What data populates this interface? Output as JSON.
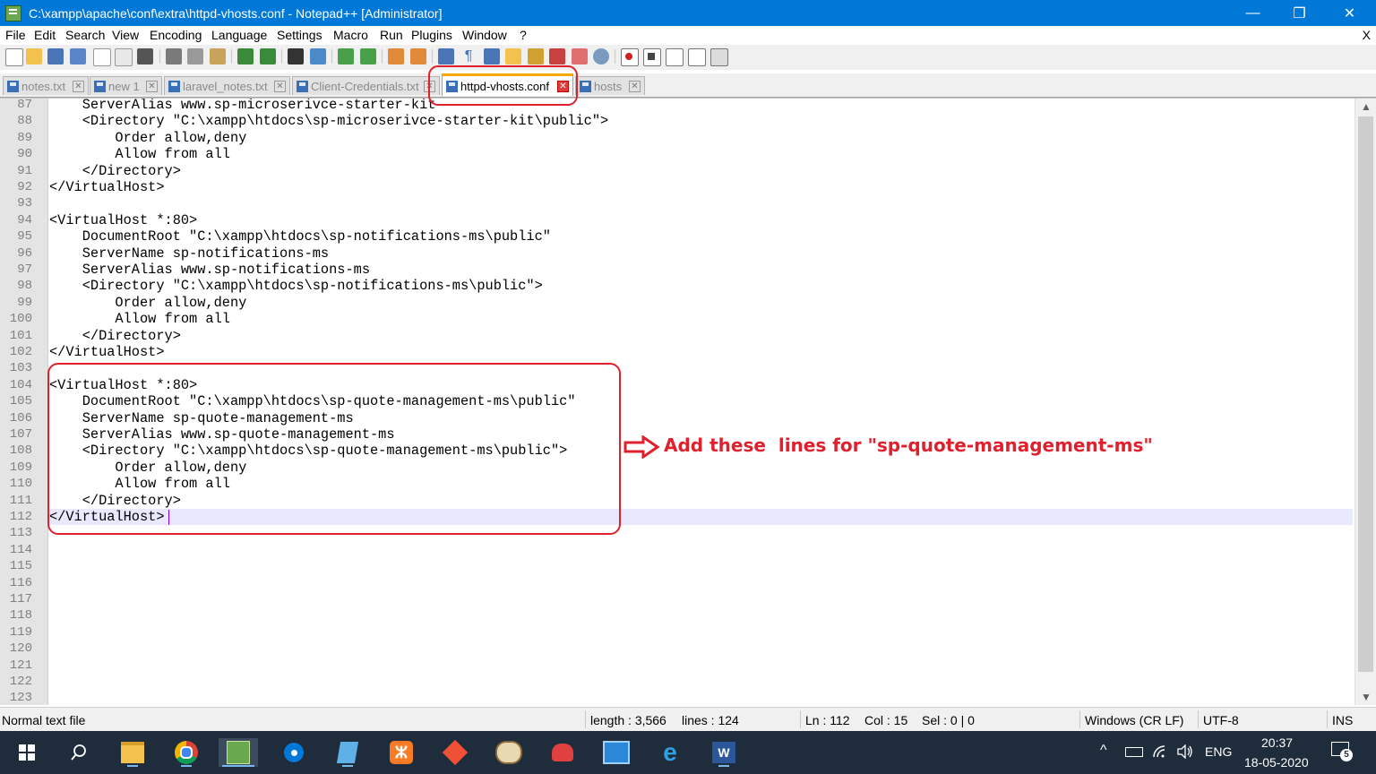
{
  "window": {
    "title": "C:\\xampp\\apache\\conf\\extra\\httpd-vhosts.conf - Notepad++ [Administrator]",
    "minimize_glyph": "—",
    "maximize_glyph": "❐",
    "close_glyph": "✕"
  },
  "menu": {
    "items": [
      "File",
      "Edit",
      "Search",
      "View",
      "Encoding",
      "Language",
      "Settings",
      "Macro",
      "Run",
      "Plugins",
      "Window",
      "?"
    ],
    "close_label": "X"
  },
  "tabs": [
    {
      "label": "notes.txt",
      "active": false
    },
    {
      "label": "new 1",
      "active": false
    },
    {
      "label": "laravel_notes.txt",
      "active": false
    },
    {
      "label": "Client-Credentials.txt",
      "active": false
    },
    {
      "label": "httpd-vhosts.conf",
      "active": true
    },
    {
      "label": "hosts",
      "active": false
    }
  ],
  "editor": {
    "first_line_number": 87,
    "current_line": 112,
    "lines": [
      "    ServerAlias www.sp-microserivce-starter-kit",
      "    <Directory \"C:\\xampp\\htdocs\\sp-microserivce-starter-kit\\public\">",
      "        Order allow,deny",
      "        Allow from all",
      "    </Directory>",
      "</VirtualHost>",
      "",
      "<VirtualHost *:80>",
      "    DocumentRoot \"C:\\xampp\\htdocs\\sp-notifications-ms\\public\"",
      "    ServerName sp-notifications-ms",
      "    ServerAlias www.sp-notifications-ms",
      "    <Directory \"C:\\xampp\\htdocs\\sp-notifications-ms\\public\">",
      "        Order allow,deny",
      "        Allow from all",
      "    </Directory>",
      "</VirtualHost>",
      "",
      "<VirtualHost *:80>",
      "    DocumentRoot \"C:\\xampp\\htdocs\\sp-quote-management-ms\\public\"",
      "    ServerName sp-quote-management-ms",
      "    ServerAlias www.sp-quote-management-ms",
      "    <Directory \"C:\\xampp\\htdocs\\sp-quote-management-ms\\public\">",
      "        Order allow,deny",
      "        Allow from all",
      "    </Directory>",
      "</VirtualHost>",
      "",
      "",
      "",
      "",
      "",
      "",
      "",
      "",
      "",
      "",
      "",
      ""
    ]
  },
  "annotation": {
    "text": "Add these  lines for \"sp-quote-management-ms\"",
    "color": "#e0202d"
  },
  "status": {
    "file_type": "Normal text file",
    "length": "length : 3,566",
    "lines": "lines : 124",
    "ln": "Ln : 112",
    "col": "Col : 15",
    "sel": "Sel : 0 | 0",
    "eol": "Windows (CR LF)",
    "encoding": "UTF-8",
    "mode": "INS"
  },
  "taskbar": {
    "language": "ENG",
    "time": "20:37",
    "date": "18-05-2020",
    "notification_count": "5"
  },
  "colors": {
    "titlebar": "#0078d7",
    "active_tab_accent": "#f6a800",
    "current_line": "#e8e8ff",
    "taskbar": "#1f2c3c"
  }
}
